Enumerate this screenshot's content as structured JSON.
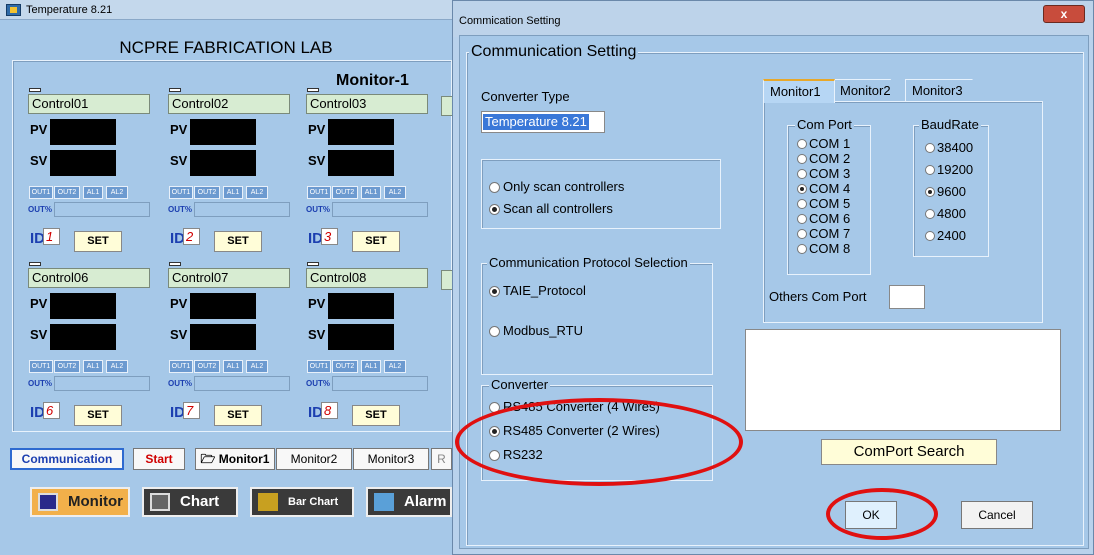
{
  "main": {
    "title": "Temperature 8.21",
    "lab_title": "NCPRE FABRICATION LAB",
    "monitor_label": "Monitor-1",
    "controllers": [
      {
        "name": "Control01",
        "id": "1"
      },
      {
        "name": "Control02",
        "id": "2"
      },
      {
        "name": "Control03",
        "id": "3"
      },
      {
        "name": "Control06",
        "id": "6"
      },
      {
        "name": "Control07",
        "id": "7"
      },
      {
        "name": "Control08",
        "id": "8"
      }
    ],
    "pv_label": "PV",
    "sv_label": "SV",
    "indicators": [
      "OUT1",
      "OUT2",
      "AL1",
      "AL2"
    ],
    "out_pct_label": "OUT%",
    "id_label": "ID",
    "set_label": "SET",
    "buttons": {
      "communication": "Communication",
      "start": "Start",
      "monitor1": "Monitor1",
      "monitor2": "Monitor2",
      "monitor3": "Monitor3",
      "r": "R"
    },
    "nav": {
      "monitor": "Monitor",
      "chart": "Chart",
      "bar_chart": "Bar Chart",
      "alarm": "Alarm"
    }
  },
  "dialog": {
    "title": "Commication Setting",
    "group_title": "Communication Setting",
    "converter_type_label": "Converter Type",
    "converter_type_value": "Temperature 8.21",
    "scan_options": [
      {
        "label": "Only scan controllers",
        "selected": false
      },
      {
        "label": "Scan all controllers",
        "selected": true
      }
    ],
    "protocol_group": "Communication Protocol Selection",
    "protocols": [
      {
        "label": "TAIE_Protocol",
        "selected": true
      },
      {
        "label": "Modbus_RTU",
        "selected": false
      }
    ],
    "converter_group": "Converter",
    "converters": [
      {
        "label": "RS485 Converter (4 Wires)",
        "selected": false
      },
      {
        "label": "RS485 Converter (2 Wires)",
        "selected": true
      },
      {
        "label": "RS232",
        "selected": false
      }
    ],
    "tabs": [
      "Monitor1",
      "Monitor2",
      "Monitor3"
    ],
    "com_port_label": "Com Port",
    "com_ports": [
      {
        "label": "COM 1",
        "selected": false
      },
      {
        "label": "COM 2",
        "selected": false
      },
      {
        "label": "COM 3",
        "selected": false
      },
      {
        "label": "COM 4",
        "selected": true
      },
      {
        "label": "COM 5",
        "selected": false
      },
      {
        "label": "COM 6",
        "selected": false
      },
      {
        "label": "COM 7",
        "selected": false
      },
      {
        "label": "COM 8",
        "selected": false
      }
    ],
    "baud_label": "BaudRate",
    "baud_rates": [
      {
        "label": "38400",
        "selected": false
      },
      {
        "label": "19200",
        "selected": false
      },
      {
        "label": "9600",
        "selected": true
      },
      {
        "label": "4800",
        "selected": false
      },
      {
        "label": "2400",
        "selected": false
      }
    ],
    "others_com_label": "Others Com Port",
    "search_label": "ComPort Search",
    "ok_label": "OK",
    "cancel_label": "Cancel",
    "close_glyph": "x"
  },
  "colors": {
    "panel_bg": "#a6c8e8",
    "annotation_red": "#e01010",
    "led_display": "#000000",
    "control_name_bg": "#d7ecd2"
  }
}
